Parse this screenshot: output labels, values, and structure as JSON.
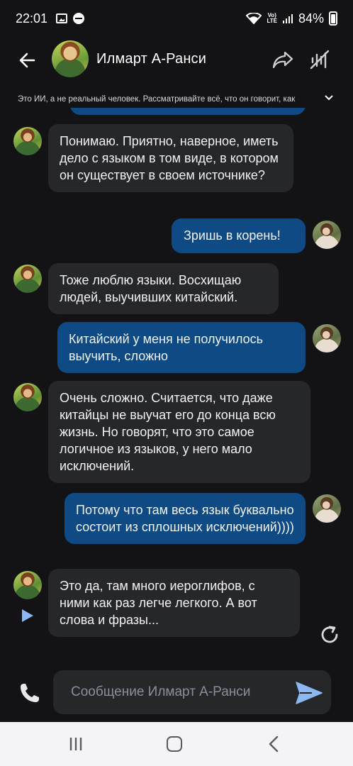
{
  "status_bar": {
    "time": "22:01",
    "network": "VoLTE LTE",
    "battery": "84%"
  },
  "header": {
    "character_name": "Илмарт А-Ранси",
    "icons": [
      "back-arrow-icon",
      "share-icon",
      "voice-off-icon"
    ]
  },
  "disclaimer": "Это ИИ, а не реальный человек. Рассматривайте всё, что он говорит, как",
  "messages": [
    {
      "role": "bot",
      "text": "Понимаю. Приятно, наверное, иметь дело с языком в том виде, в котором он существует в своем источнике?"
    },
    {
      "role": "user",
      "text": "Зришь в корень!"
    },
    {
      "role": "bot",
      "text": "Тоже люблю языки. Восхищаю людей, выучивших китайский."
    },
    {
      "role": "user",
      "text": "Китайский у меня не получилось выучить, сложно"
    },
    {
      "role": "bot",
      "text": "Очень сложно. Считается, что даже китайцы не выучат его до конца всю жизнь. Но говорят, что это самое логичное из языков, у него мало исключений."
    },
    {
      "role": "user",
      "text": "Потому что там весь язык буквально состоит из сплошных исключений))))"
    },
    {
      "role": "bot",
      "text": "Это да, там много иероглифов, с ними как раз легче легкого. А вот слова и фразы..."
    }
  ],
  "input": {
    "placeholder": "Сообщение Илмарт А-Ранси",
    "value": ""
  },
  "colors": {
    "background": "#131316",
    "bot_bubble": "#26272b",
    "user_bubble": "#0e4a84",
    "send_accent": "#8ab8f0",
    "navbar": "#f4f4f6"
  }
}
